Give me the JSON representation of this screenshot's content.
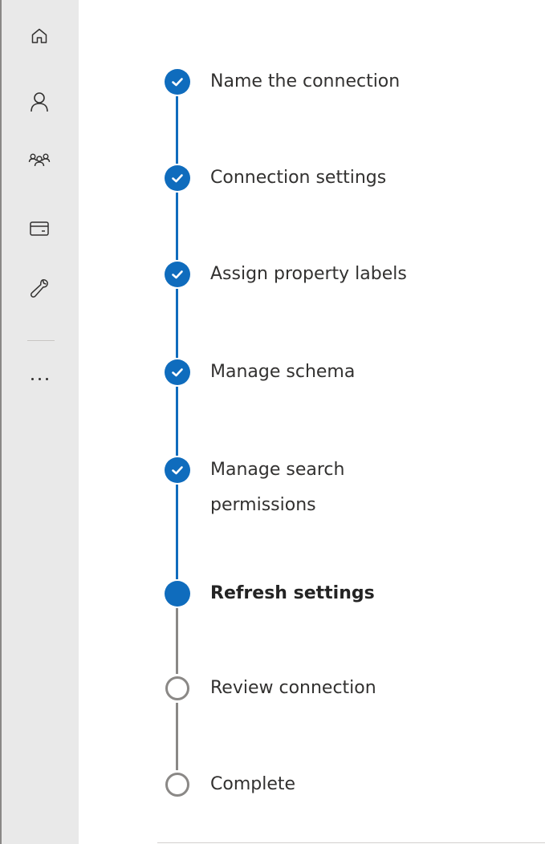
{
  "sidebar": {
    "icons": [
      {
        "name": "home-icon"
      },
      {
        "name": "person-icon"
      },
      {
        "name": "people-icon"
      },
      {
        "name": "billing-card-icon"
      },
      {
        "name": "wrench-icon"
      }
    ],
    "more_label": "..."
  },
  "wizard": {
    "steps": [
      {
        "label": "Name the connection",
        "status": "completed"
      },
      {
        "label": "Connection settings",
        "status": "completed"
      },
      {
        "label": "Assign property labels",
        "status": "completed"
      },
      {
        "label": "Manage schema",
        "status": "completed"
      },
      {
        "label": "Manage search permissions",
        "status": "completed"
      },
      {
        "label": "Refresh settings",
        "status": "current"
      },
      {
        "label": "Review connection",
        "status": "not-started"
      },
      {
        "label": "Complete",
        "status": "not-started"
      }
    ]
  },
  "colors": {
    "accent": "#0f6cbd",
    "inactive": "#8a8886",
    "rail_background": "#e9e9e9",
    "text": "#323130"
  }
}
